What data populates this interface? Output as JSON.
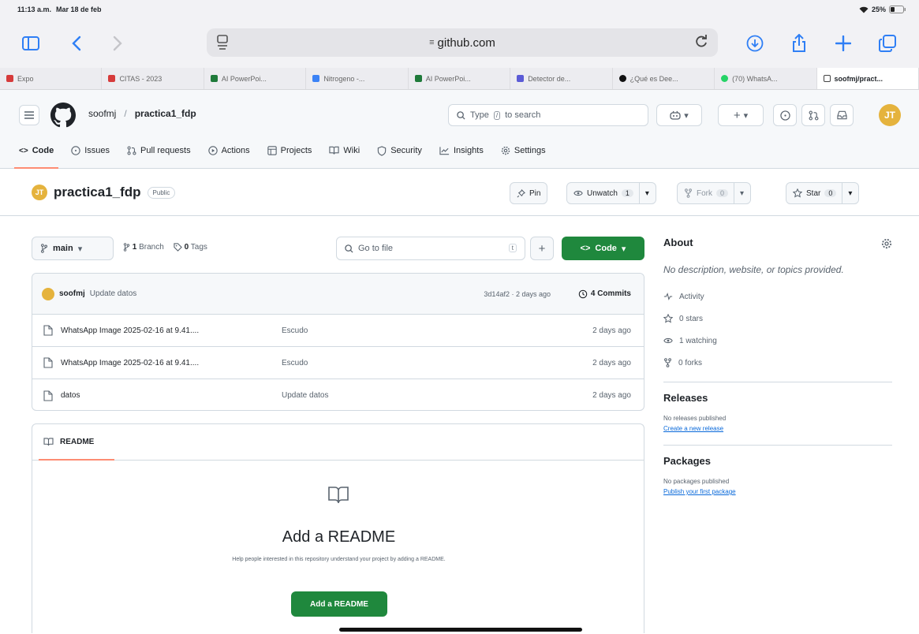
{
  "status": {
    "time": "11:13 a.m.",
    "date": "Mar 18 de feb",
    "battery": "25%"
  },
  "browser": {
    "address": "github.com",
    "tabs": [
      {
        "label": "Expo",
        "color": "#d63b3b"
      },
      {
        "label": "CITAS - 2023",
        "color": "#d63b3b"
      },
      {
        "label": "AI PowerPoi...",
        "color": "#1f7a3a"
      },
      {
        "label": "Nitrogeno -...",
        "color": "#3b82f6"
      },
      {
        "label": "AI PowerPoi...",
        "color": "#1f7a3a"
      },
      {
        "label": "Detector de...",
        "color": "#5b5bd6"
      },
      {
        "label": "¿Qué es Dee...",
        "color": "#111111"
      },
      {
        "label": "(70) WhatsA...",
        "color": "#25d366"
      },
      {
        "label": "soofmj/pract...",
        "color": "#444444"
      }
    ]
  },
  "header": {
    "owner": "soofmj",
    "separator": "/",
    "repo": "practica1_fdp",
    "search_pre": "Type",
    "search_key": "/",
    "search_post": "to search",
    "avatar_text": "JT"
  },
  "nav": {
    "code": "Code",
    "issues": "Issues",
    "pulls": "Pull requests",
    "actions": "Actions",
    "projects": "Projects",
    "wiki": "Wiki",
    "security": "Security",
    "insights": "Insights",
    "settings": "Settings"
  },
  "repo_head": {
    "name": "practica1_fdp",
    "visibility": "Public",
    "pin": "Pin",
    "unwatch": "Unwatch",
    "watch_count": "1",
    "fork": "Fork",
    "fork_count": "0",
    "star": "Star",
    "star_count": "0"
  },
  "branch": {
    "name": "main",
    "branches_count": "1",
    "branches_label": "Branch",
    "tags_count": "0",
    "tags_label": "Tags",
    "goto": "Go to file",
    "goto_key": "t",
    "code_button": "Code"
  },
  "commit": {
    "user": "soofmj",
    "message": "Update datos",
    "hash": "3d14af2 · 2 days ago",
    "commits": "4 Commits"
  },
  "files": [
    {
      "name": "WhatsApp Image 2025-02-16 at 9.41....",
      "message": "Escudo",
      "date": "2 days ago"
    },
    {
      "name": "WhatsApp Image 2025-02-16 at 9.41....",
      "message": "Escudo",
      "date": "2 days ago"
    },
    {
      "name": "datos",
      "message": "Update datos",
      "date": "2 days ago"
    }
  ],
  "readme": {
    "tab": "README",
    "title": "Add a README",
    "desc": "Help people interested in this repository understand your project by adding a README.",
    "button": "Add a README"
  },
  "about": {
    "title": "About",
    "desc": "No description, website, or topics provided.",
    "activity": "Activity",
    "stars": "0 stars",
    "watching": "1 watching",
    "forks": "0 forks"
  },
  "releases": {
    "title": "Releases",
    "none": "No releases published",
    "link": "Create a new release"
  },
  "packages": {
    "title": "Packages",
    "none": "No packages published",
    "link": "Publish your first package"
  }
}
